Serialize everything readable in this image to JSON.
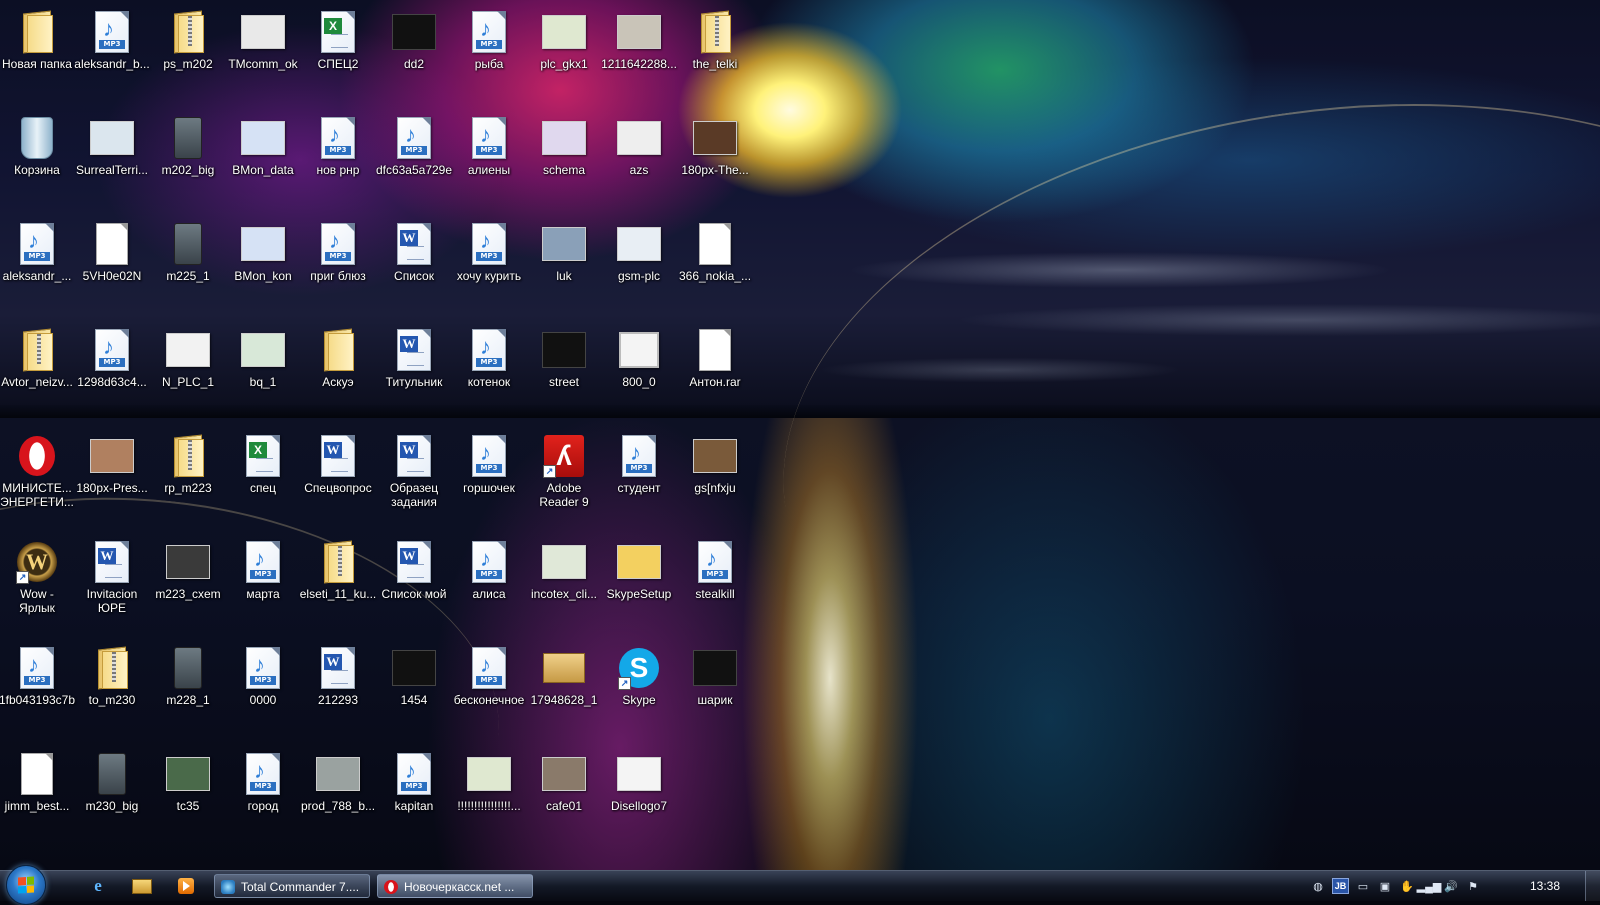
{
  "desktop": {
    "icons": [
      {
        "label": "Новая папка",
        "type": "folder"
      },
      {
        "label": "aleksandr_b...",
        "type": "mp3"
      },
      {
        "label": "ps_m202",
        "type": "zip"
      },
      {
        "label": "TMcomm_ok",
        "type": "img",
        "color": "#e9e9e9"
      },
      {
        "label": "СПЕЦ2",
        "type": "excel"
      },
      {
        "label": "dd2",
        "type": "dark"
      },
      {
        "label": "рыба",
        "type": "mp3"
      },
      {
        "label": "plc_gkx1",
        "type": "img",
        "color": "#dfe8d0"
      },
      {
        "label": "1211642288...",
        "type": "img",
        "color": "#c9c4b8"
      },
      {
        "label": "the_telki",
        "type": "zip"
      },
      {
        "label": "Корзина",
        "type": "bin"
      },
      {
        "label": "SurrealTerri...",
        "type": "img",
        "color": "#dbe6ee"
      },
      {
        "label": "m202_big",
        "type": "meter"
      },
      {
        "label": "BMon_data",
        "type": "img",
        "color": "#d6e2f5"
      },
      {
        "label": "нов рнр",
        "type": "mp3"
      },
      {
        "label": "dfc63a5a729e",
        "type": "mp3"
      },
      {
        "label": "алиены",
        "type": "mp3"
      },
      {
        "label": "schema",
        "type": "img",
        "color": "#e0d8ee"
      },
      {
        "label": "azs",
        "type": "img",
        "color": "#eeeeee"
      },
      {
        "label": "180px-The...",
        "type": "img",
        "color": "#5a3a26"
      },
      {
        "label": "aleksandr_...",
        "type": "mp3"
      },
      {
        "label": "5VH0e02N",
        "type": "blank"
      },
      {
        "label": "m225_1",
        "type": "meter"
      },
      {
        "label": "BMon_kon",
        "type": "img",
        "color": "#d6e2f5"
      },
      {
        "label": "приг блюз",
        "type": "mp3"
      },
      {
        "label": "Список",
        "type": "word"
      },
      {
        "label": "хочу курить",
        "type": "mp3"
      },
      {
        "label": "luk",
        "type": "img",
        "color": "#8aa0b8"
      },
      {
        "label": "gsm-plc",
        "type": "img",
        "color": "#e8eef4"
      },
      {
        "label": "366_nokia_...",
        "type": "blank"
      },
      {
        "label": "Avtor_neizv...",
        "type": "zip"
      },
      {
        "label": "1298d63c4...",
        "type": "mp3"
      },
      {
        "label": "N_PLC_1",
        "type": "img",
        "color": "#f2f2f2"
      },
      {
        "label": "bq_1",
        "type": "img",
        "color": "#d8e8d8"
      },
      {
        "label": "Аскуэ",
        "type": "folder"
      },
      {
        "label": "Титульник",
        "type": "word"
      },
      {
        "label": "котенок",
        "type": "mp3"
      },
      {
        "label": "street",
        "type": "dark"
      },
      {
        "label": "800_0",
        "type": "pc"
      },
      {
        "label": "Антон.rar",
        "type": "blank"
      },
      {
        "label": "МИНИСТЕ...\nЭНЕРГЕТИ...",
        "type": "opera"
      },
      {
        "label": "180px-Pres...",
        "type": "img",
        "color": "#b08060"
      },
      {
        "label": "rp_m223",
        "type": "zip"
      },
      {
        "label": "спец",
        "type": "excel"
      },
      {
        "label": "Спецвопрос",
        "type": "word"
      },
      {
        "label": "Образец\nзадания",
        "type": "word"
      },
      {
        "label": "горшочек",
        "type": "mp3"
      },
      {
        "label": "Adobe\nReader 9",
        "type": "acrobat",
        "shortcut": true
      },
      {
        "label": "студент",
        "type": "mp3"
      },
      {
        "label": "gs[nfxju",
        "type": "img",
        "color": "#7a5a3a"
      },
      {
        "label": "Wow -\nЯрлык",
        "type": "wow",
        "shortcut": true
      },
      {
        "label": "Invitacion\nЮРЕ",
        "type": "word"
      },
      {
        "label": "m223_cxem",
        "type": "img",
        "color": "#3a3a3a"
      },
      {
        "label": "марта",
        "type": "mp3"
      },
      {
        "label": "elseti_11_ku...",
        "type": "zip"
      },
      {
        "label": "Список мой",
        "type": "word"
      },
      {
        "label": "алиса",
        "type": "mp3"
      },
      {
        "label": "incotex_cli...",
        "type": "img",
        "color": "#e0e8d8"
      },
      {
        "label": "SkypeSetup",
        "type": "img",
        "color": "#f3d060"
      },
      {
        "label": "stealkill",
        "type": "mp3"
      },
      {
        "label": "1fb043193c7b",
        "type": "mp3"
      },
      {
        "label": "to_m230",
        "type": "zip"
      },
      {
        "label": "m228_1",
        "type": "meter"
      },
      {
        "label": "0000",
        "type": "mp3"
      },
      {
        "label": "212293",
        "type": "word"
      },
      {
        "label": "1454",
        "type": "dark"
      },
      {
        "label": "бесконечное",
        "type": "mp3"
      },
      {
        "label": "17948628_1",
        "type": "box"
      },
      {
        "label": "Skype",
        "type": "skype",
        "shortcut": true
      },
      {
        "label": "шарик",
        "type": "dark"
      },
      {
        "label": "jimm_best...",
        "type": "blank"
      },
      {
        "label": "m230_big",
        "type": "meter"
      },
      {
        "label": "tc35",
        "type": "img",
        "color": "#4a6a4a"
      },
      {
        "label": "город",
        "type": "mp3"
      },
      {
        "label": "prod_788_b...",
        "type": "img",
        "color": "#9aa2a0"
      },
      {
        "label": "kapitan",
        "type": "mp3"
      },
      {
        "label": "!!!!!!!!!!!!!!!!...",
        "type": "img",
        "color": "#dfe8d0"
      },
      {
        "label": "cafe01",
        "type": "img",
        "color": "#8a7a6a"
      },
      {
        "label": "Disellogo7",
        "type": "img",
        "color": "#f4f4f4"
      }
    ]
  },
  "taskbar": {
    "start_label": "Start",
    "quicklaunch": [
      "internet-explorer-icon",
      "explorer-icon",
      "media-player-icon"
    ],
    "tasks": [
      {
        "label": "Total Commander 7...."
      },
      {
        "label": "Новочеркасск.net ..."
      }
    ],
    "tray": {
      "lang": "JB"
    },
    "clock": "13:38"
  }
}
